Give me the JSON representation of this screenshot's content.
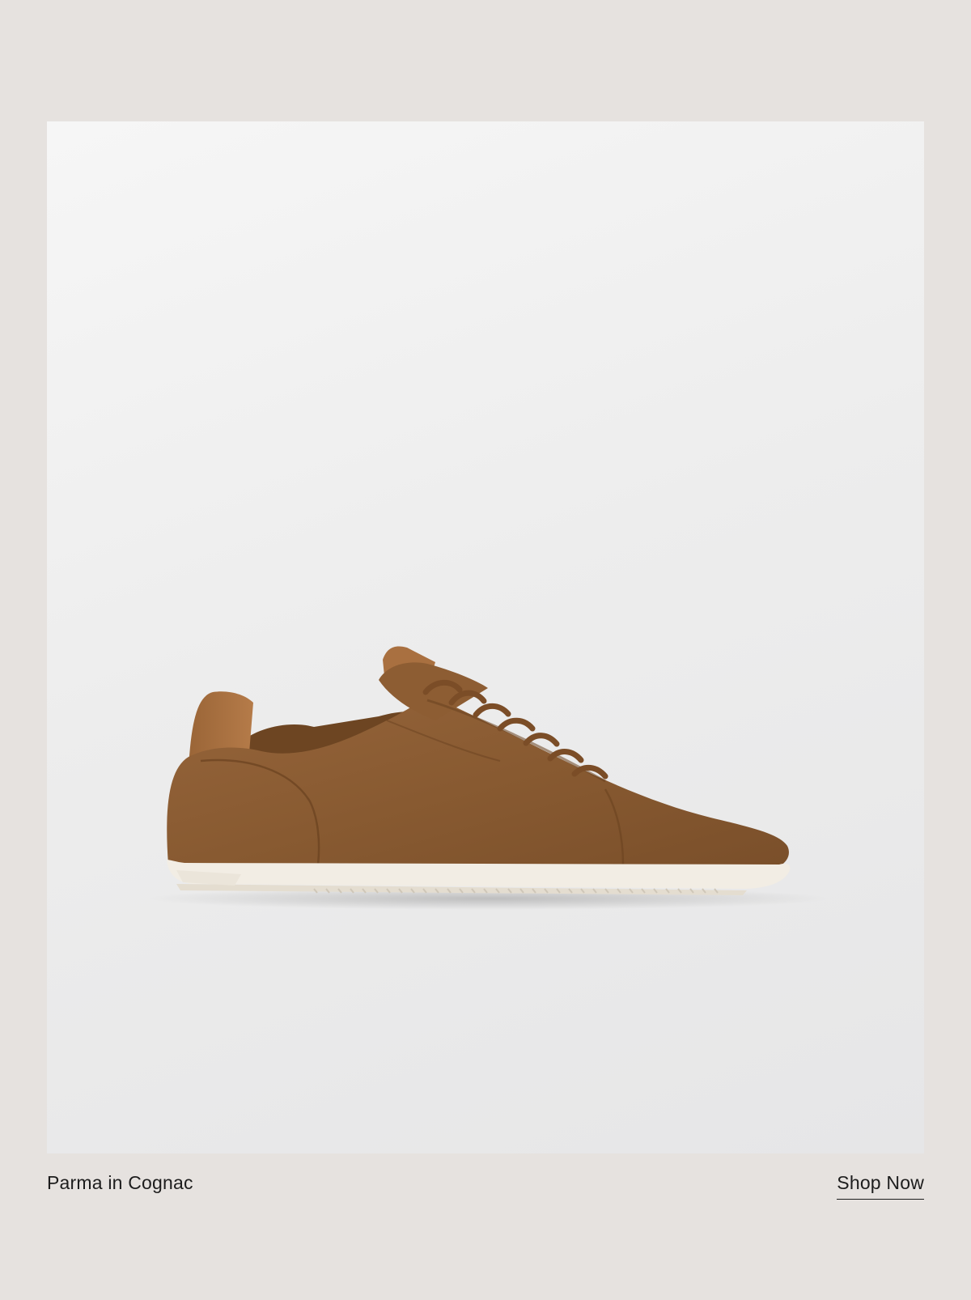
{
  "product": {
    "name": "Parma in Cognac",
    "image_alt": "Cognac suede low-top sneaker with white sole",
    "icon": "sneaker-illustration"
  },
  "cta": {
    "label": "Shop Now"
  },
  "colors": {
    "page_background": "#e6e2df",
    "image_background": "#ededed",
    "suede": "#8a5a30",
    "leather_heel": "#a56d3e",
    "sole": "#f2ede4",
    "text": "#1d1d1d"
  }
}
